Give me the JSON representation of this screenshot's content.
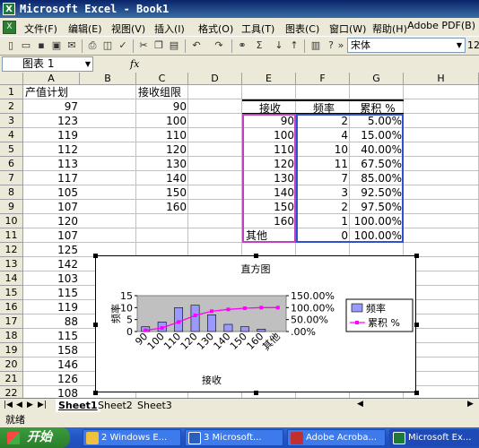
{
  "window": {
    "title": "Microsoft Excel - Book1"
  },
  "menu": [
    "文件(F)",
    "编辑(E)",
    "视图(V)",
    "插入(I)",
    "格式(O)",
    "工具(T)",
    "图表(C)",
    "窗口(W)",
    "帮助(H)"
  ],
  "menu_help_box": "Adobe PDF(B)",
  "toolbar": {
    "font_name": "宋体",
    "font_size": "12"
  },
  "formula": {
    "name_box": "图表 1",
    "fx": "fx"
  },
  "columns": [
    "A",
    "B",
    "C",
    "D",
    "E",
    "F",
    "G",
    "H"
  ],
  "rows": [
    "1",
    "2",
    "3",
    "4",
    "5",
    "6",
    "7",
    "8",
    "9",
    "10",
    "11",
    "12",
    "13",
    "14",
    "15",
    "16",
    "17",
    "18",
    "19",
    "20",
    "21",
    "22"
  ],
  "cells": {
    "A1": "产值计划",
    "C1": "接收组限",
    "A": [
      "97",
      "123",
      "119",
      "112",
      "113",
      "117",
      "105",
      "107",
      "120",
      "107",
      "125",
      "142",
      "103",
      "115",
      "119",
      "88",
      "115",
      "158",
      "146",
      "126",
      "108"
    ],
    "C": [
      "90",
      "100",
      "110",
      "120",
      "130",
      "140",
      "150",
      "160"
    ],
    "E1": "接收",
    "F1": "频率",
    "G1": "累积 %",
    "E": [
      "90",
      "100",
      "110",
      "120",
      "130",
      "140",
      "150",
      "160",
      "其他"
    ],
    "F": [
      "2",
      "4",
      "10",
      "11",
      "7",
      "3",
      "2",
      "1",
      "0"
    ],
    "G": [
      "5.00%",
      "15.00%",
      "40.00%",
      "67.50%",
      "85.00%",
      "92.50%",
      "97.50%",
      "100.00%",
      "100.00%"
    ]
  },
  "chart_data": {
    "type": "bar",
    "title": "直方图",
    "xlabel": "接收",
    "ylabel": "频率",
    "categories": [
      "90",
      "100",
      "110",
      "120",
      "130",
      "140",
      "150",
      "160",
      "其他"
    ],
    "series": [
      {
        "name": "频率",
        "type": "bar",
        "values": [
          2,
          4,
          10,
          11,
          7,
          3,
          2,
          1,
          0
        ],
        "color": "#9999ff"
      },
      {
        "name": "累积 %",
        "type": "line",
        "values": [
          5.0,
          15.0,
          40.0,
          67.5,
          85.0,
          92.5,
          97.5,
          100.0,
          100.0
        ],
        "color": "#ff00ff"
      }
    ],
    "y_left_ticks": [
      "0",
      "5",
      "10",
      "15"
    ],
    "y_left_range": [
      0,
      15
    ],
    "y_right_ticks": [
      ".00%",
      "50.00%",
      "100.00%",
      "150.00%"
    ],
    "y_right_range": [
      0,
      150
    ],
    "legend": "right",
    "plot_bg": "#c0c0c0"
  },
  "sheets": [
    "Sheet1",
    "Sheet2",
    "Sheet3"
  ],
  "status": "就绪",
  "taskbar": {
    "start": "开始",
    "tasks": [
      "2 Windows E...",
      "3 Microsoft...",
      "Adobe Acroba...",
      "Microsoft Ex..."
    ]
  }
}
